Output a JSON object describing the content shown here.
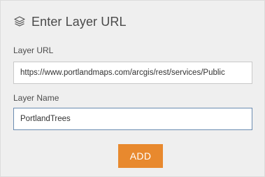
{
  "header": {
    "title": "Enter Layer URL",
    "icon": "layers-icon"
  },
  "layer_url": {
    "label": "Layer URL",
    "value": "https://www.portlandmaps.com/arcgis/rest/services/Public"
  },
  "layer_name": {
    "label": "Layer Name",
    "value": "PortlandTrees"
  },
  "actions": {
    "add_label": "ADD"
  },
  "colors": {
    "accent": "#e8892e",
    "panel_bg": "#efefef",
    "focus_border": "#6a8bb0"
  }
}
